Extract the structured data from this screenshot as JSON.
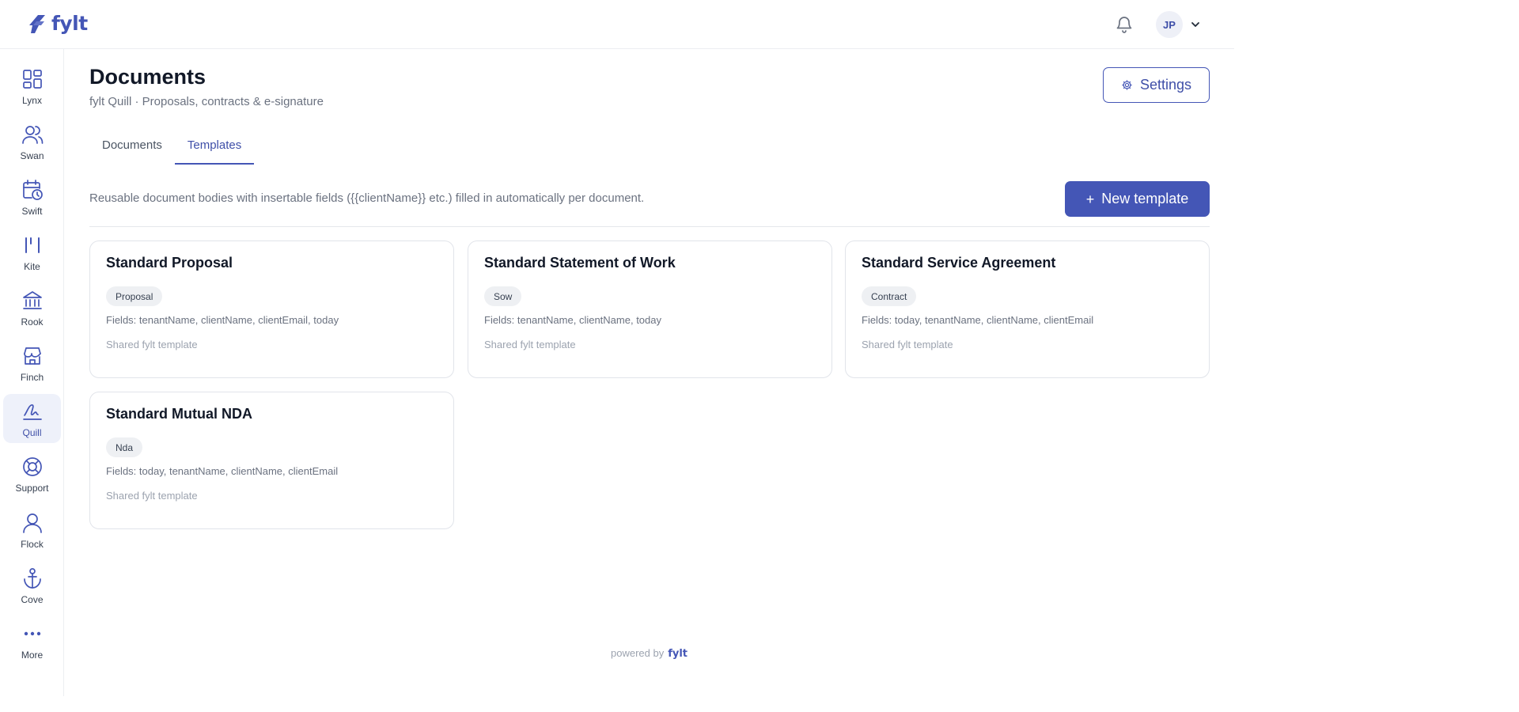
{
  "brand": {
    "name": "fylt",
    "color": "#4456b6"
  },
  "header": {
    "avatar_initials": "JP",
    "notifications_icon": "bell-icon",
    "menu_icon": "chevron-down-icon"
  },
  "sidebar": {
    "items": [
      {
        "label": "Lynx",
        "icon": "grid-icon"
      },
      {
        "label": "Swan",
        "icon": "users-icon"
      },
      {
        "label": "Swift",
        "icon": "calendar-clock-icon"
      },
      {
        "label": "Kite",
        "icon": "kite-icon"
      },
      {
        "label": "Rook",
        "icon": "bank-icon"
      },
      {
        "label": "Finch",
        "icon": "store-icon"
      },
      {
        "label": "Quill",
        "icon": "signature-icon",
        "active": true
      },
      {
        "label": "Support",
        "icon": "lifebuoy-icon"
      },
      {
        "label": "Flock",
        "icon": "user-icon"
      },
      {
        "label": "Cove",
        "icon": "anchor-icon"
      },
      {
        "label": "More",
        "icon": "more-icon"
      }
    ]
  },
  "page": {
    "title": "Documents",
    "subtitle": "fylt Quill · Proposals, contracts & e-signature",
    "settings_label": "Settings"
  },
  "tabs": [
    {
      "label": "Documents",
      "active": false
    },
    {
      "label": "Templates",
      "active": true
    }
  ],
  "templates": {
    "description": "Reusable document bodies with insertable fields ({{clientName}} etc.) filled in automatically per document.",
    "new_button_label": "New template",
    "cards": [
      {
        "title": "Standard Proposal",
        "badge": "Proposal",
        "fields": "Fields: tenantName, clientName, clientEmail, today",
        "shared": "Shared fylt template"
      },
      {
        "title": "Standard Statement of Work",
        "badge": "Sow",
        "fields": "Fields: tenantName, clientName, today",
        "shared": "Shared fylt template"
      },
      {
        "title": "Standard Service Agreement",
        "badge": "Contract",
        "fields": "Fields: today, tenantName, clientName, clientEmail",
        "shared": "Shared fylt template"
      },
      {
        "title": "Standard Mutual NDA",
        "badge": "Nda",
        "fields": "Fields: today, tenantName, clientName, clientEmail",
        "shared": "Shared fylt template"
      }
    ]
  },
  "footer": {
    "powered_by": "powered by",
    "brand": "fylt"
  }
}
